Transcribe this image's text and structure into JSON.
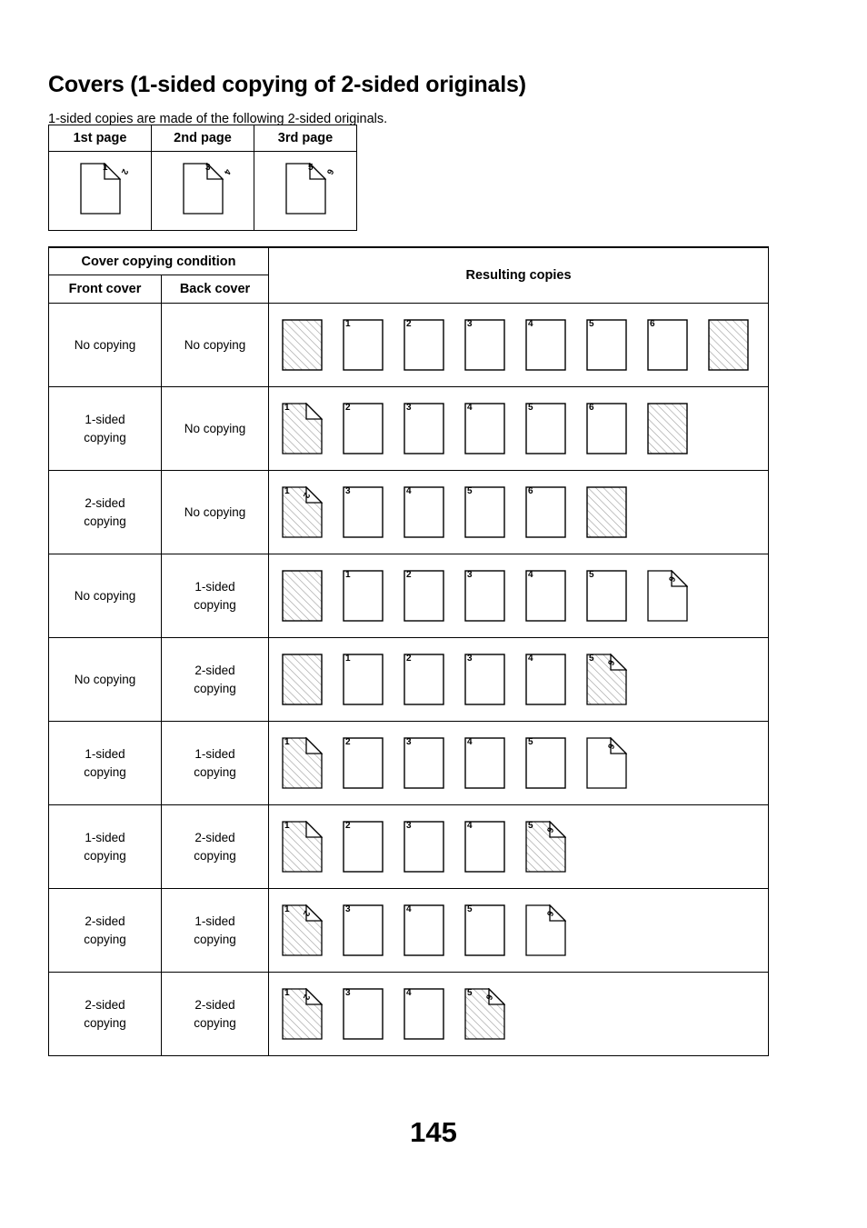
{
  "document": {
    "title": "Covers (1-sided copying of 2-sided originals)",
    "subtitle": "1-sided copies are made of the following 2-sided originals.",
    "page_number": "145"
  },
  "originals_table": {
    "headers": [
      "1st page",
      "2nd page",
      "3rd page"
    ],
    "sheets": [
      {
        "style": "plain",
        "front": "1",
        "back": "2",
        "fold": true
      },
      {
        "style": "plain",
        "front": "3",
        "back": "4",
        "fold": true
      },
      {
        "style": "plain",
        "front": "5",
        "back": "6",
        "fold": true
      }
    ]
  },
  "main_table": {
    "group_header": "Cover copying condition",
    "headers": {
      "front_cover": "Front cover",
      "back_cover": "Back cover",
      "resulting_copies": "Resulting copies"
    },
    "labels": {
      "no_copying": "No copying",
      "one_sided": "1-sided copying",
      "two_sided": "2-sided copying"
    },
    "rows": [
      {
        "front_cover": "No copying",
        "back_cover": "No copying",
        "sheets": [
          {
            "style": "hatched",
            "front": "",
            "back": "",
            "fold": false
          },
          {
            "style": "plain",
            "front": "1",
            "back": "",
            "fold": false
          },
          {
            "style": "plain",
            "front": "2",
            "back": "",
            "fold": false
          },
          {
            "style": "plain",
            "front": "3",
            "back": "",
            "fold": false
          },
          {
            "style": "plain",
            "front": "4",
            "back": "",
            "fold": false
          },
          {
            "style": "plain",
            "front": "5",
            "back": "",
            "fold": false
          },
          {
            "style": "plain",
            "front": "6",
            "back": "",
            "fold": false
          },
          {
            "style": "hatched",
            "front": "",
            "back": "",
            "fold": false
          }
        ]
      },
      {
        "front_cover": "1-sided copying",
        "back_cover": "No copying",
        "sheets": [
          {
            "style": "hatched",
            "front": "1",
            "back": "",
            "fold": true
          },
          {
            "style": "plain",
            "front": "2",
            "back": "",
            "fold": false
          },
          {
            "style": "plain",
            "front": "3",
            "back": "",
            "fold": false
          },
          {
            "style": "plain",
            "front": "4",
            "back": "",
            "fold": false
          },
          {
            "style": "plain",
            "front": "5",
            "back": "",
            "fold": false
          },
          {
            "style": "plain",
            "front": "6",
            "back": "",
            "fold": false
          },
          {
            "style": "hatched",
            "front": "",
            "back": "",
            "fold": false
          }
        ]
      },
      {
        "front_cover": "2-sided copying",
        "back_cover": "No copying",
        "sheets": [
          {
            "style": "hatched",
            "front": "1",
            "back": "2",
            "fold": true
          },
          {
            "style": "plain",
            "front": "3",
            "back": "",
            "fold": false
          },
          {
            "style": "plain",
            "front": "4",
            "back": "",
            "fold": false
          },
          {
            "style": "plain",
            "front": "5",
            "back": "",
            "fold": false
          },
          {
            "style": "plain",
            "front": "6",
            "back": "",
            "fold": false
          },
          {
            "style": "hatched",
            "front": "",
            "back": "",
            "fold": false
          }
        ]
      },
      {
        "front_cover": "No copying",
        "back_cover": "1-sided copying",
        "sheets": [
          {
            "style": "hatched",
            "front": "",
            "back": "",
            "fold": false
          },
          {
            "style": "plain",
            "front": "1",
            "back": "",
            "fold": false
          },
          {
            "style": "plain",
            "front": "2",
            "back": "",
            "fold": false
          },
          {
            "style": "plain",
            "front": "3",
            "back": "",
            "fold": false
          },
          {
            "style": "plain",
            "front": "4",
            "back": "",
            "fold": false
          },
          {
            "style": "plain",
            "front": "5",
            "back": "",
            "fold": false
          },
          {
            "style": "plain",
            "front": "",
            "back": "6",
            "fold": true
          }
        ]
      },
      {
        "front_cover": "No copying",
        "back_cover": "2-sided copying",
        "sheets": [
          {
            "style": "hatched",
            "front": "",
            "back": "",
            "fold": false
          },
          {
            "style": "plain",
            "front": "1",
            "back": "",
            "fold": false
          },
          {
            "style": "plain",
            "front": "2",
            "back": "",
            "fold": false
          },
          {
            "style": "plain",
            "front": "3",
            "back": "",
            "fold": false
          },
          {
            "style": "plain",
            "front": "4",
            "back": "",
            "fold": false
          },
          {
            "style": "hatched",
            "front": "5",
            "back": "6",
            "fold": true
          }
        ]
      },
      {
        "front_cover": "1-sided copying",
        "back_cover": "1-sided copying",
        "sheets": [
          {
            "style": "hatched",
            "front": "1",
            "back": "",
            "fold": true
          },
          {
            "style": "plain",
            "front": "2",
            "back": "",
            "fold": false
          },
          {
            "style": "plain",
            "front": "3",
            "back": "",
            "fold": false
          },
          {
            "style": "plain",
            "front": "4",
            "back": "",
            "fold": false
          },
          {
            "style": "plain",
            "front": "5",
            "back": "",
            "fold": false
          },
          {
            "style": "plain",
            "front": "",
            "back": "6",
            "fold": true
          }
        ]
      },
      {
        "front_cover": "1-sided copying",
        "back_cover": "2-sided copying",
        "sheets": [
          {
            "style": "hatched",
            "front": "1",
            "back": "",
            "fold": true
          },
          {
            "style": "plain",
            "front": "2",
            "back": "",
            "fold": false
          },
          {
            "style": "plain",
            "front": "3",
            "back": "",
            "fold": false
          },
          {
            "style": "plain",
            "front": "4",
            "back": "",
            "fold": false
          },
          {
            "style": "hatched",
            "front": "5",
            "back": "6",
            "fold": true
          }
        ]
      },
      {
        "front_cover": "2-sided copying",
        "back_cover": "1-sided copying",
        "sheets": [
          {
            "style": "hatched",
            "front": "1",
            "back": "2",
            "fold": true
          },
          {
            "style": "plain",
            "front": "3",
            "back": "",
            "fold": false
          },
          {
            "style": "plain",
            "front": "4",
            "back": "",
            "fold": false
          },
          {
            "style": "plain",
            "front": "5",
            "back": "",
            "fold": false
          },
          {
            "style": "plain",
            "front": "",
            "back": "6",
            "fold": true
          }
        ]
      },
      {
        "front_cover": "2-sided copying",
        "back_cover": "2-sided copying",
        "sheets": [
          {
            "style": "hatched",
            "front": "1",
            "back": "2",
            "fold": true
          },
          {
            "style": "plain",
            "front": "3",
            "back": "",
            "fold": false
          },
          {
            "style": "plain",
            "front": "4",
            "back": "",
            "fold": false
          },
          {
            "style": "hatched",
            "front": "5",
            "back": "6",
            "fold": true
          }
        ]
      }
    ]
  },
  "colors": {
    "ink": "#000000",
    "paper": "#ffffff",
    "hatch": "#9a9a9a"
  }
}
